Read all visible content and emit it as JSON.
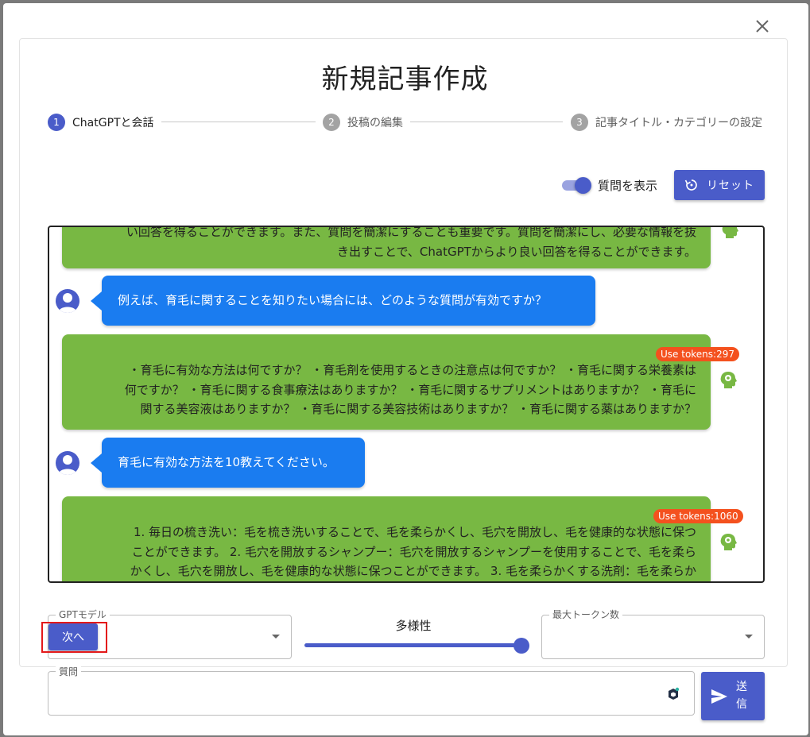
{
  "header": {
    "title": "新規記事作成"
  },
  "stepper": [
    {
      "number": "1",
      "label": "ChatGPTと会話"
    },
    {
      "number": "2",
      "label": "投稿の編集"
    },
    {
      "number": "3",
      "label": "記事タイトル・カテゴリーの設定"
    }
  ],
  "controls": {
    "show_questions_label": "質問を表示",
    "show_questions_on": true,
    "reset_label": "リセット"
  },
  "chat": {
    "messages": [
      {
        "role": "ai",
        "lines": [
          "い回答を得ることができます。また、質問を簡潔にすることも重要です。質問を簡潔にし、必要な情報を抜",
          "き出すことで、ChatGPTからより良い回答を得ることができます。"
        ]
      },
      {
        "role": "user",
        "text": "例えば、育毛に関することを知りたい場合には、どのような質問が有効ですか？"
      },
      {
        "role": "ai",
        "tokens": "Use tokens:297",
        "lines": [
          "・育毛に有効な方法は何ですか？ ・育毛剤を使用するときの注意点は何ですか？ ・育毛に関する栄養素は",
          "何ですか？ ・育毛に関する食事療法はありますか？ ・育毛に関するサプリメントはありますか？ ・育毛に",
          "関する美容液はありますか？ ・育毛に関する美容技術はありますか？ ・育毛に関する薬はありますか？"
        ]
      },
      {
        "role": "user",
        "text": "育毛に有効な方法を10教えてください。"
      },
      {
        "role": "ai",
        "tokens": "Use tokens:1060",
        "lines": [
          "1. 毎日の梳き洗い：毛を梳き洗いすることで、毛を柔らかくし、毛穴を開放し、毛を健康的な状態に保つ",
          "ことができます。 2. 毛穴を開放するシャンプー：毛穴を開放するシャンプーを使用することで、毛を柔ら",
          "かくし、毛穴を開放し、毛を健康的な状態に保つことができます。 3. 毛を柔らかくする洗剤：毛を柔らか"
        ]
      }
    ]
  },
  "settings": {
    "model_label": "GPTモデル",
    "model_value": "",
    "diversity_label": "多様性",
    "diversity_value": 1.0,
    "max_tokens_label": "最大トークン数",
    "max_tokens_value": ""
  },
  "next_button": {
    "label": "次へ"
  },
  "question": {
    "label": "質問",
    "value": "",
    "placeholder": ""
  },
  "send_button": {
    "label": "送信"
  },
  "colors": {
    "primary": "#4a5cc9",
    "ai_bubble": "#78b843",
    "user_bubble": "#1a7cf0",
    "token_badge": "#f4511e",
    "highlight": "#e3191a"
  }
}
